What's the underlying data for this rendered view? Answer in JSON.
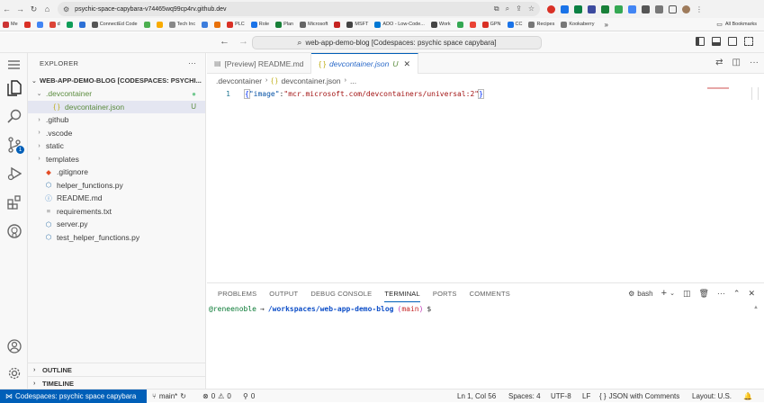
{
  "browser": {
    "url": "psychic-space-capybara-v74465wq99cp4rv.github.dev",
    "bookmarks": [
      {
        "label": "Me",
        "color": "#cc3333"
      },
      {
        "label": "",
        "color": "#d93025"
      },
      {
        "label": "",
        "color": "#4285f4"
      },
      {
        "label": "d",
        "color": "#dc4437"
      },
      {
        "label": "",
        "color": "#0f9d58"
      },
      {
        "label": "",
        "color": "#2c70d6"
      },
      {
        "label": "ConnectEd Code",
        "color": "#555555"
      },
      {
        "label": "",
        "color": "#4caf50"
      },
      {
        "label": "",
        "color": "#f9ab00"
      },
      {
        "label": "Tech Inc",
        "color": "#888888"
      },
      {
        "label": "",
        "color": "#3c7ddc"
      },
      {
        "label": "",
        "color": "#e8710a"
      },
      {
        "label": "PLC",
        "color": "#d93025"
      },
      {
        "label": "Role",
        "color": "#1a73e8"
      },
      {
        "label": "Plan",
        "color": "#188038"
      },
      {
        "label": "Microsoft",
        "color": "#666666"
      },
      {
        "label": "",
        "color": "#c5221f"
      },
      {
        "label": "MSFT",
        "color": "#444444"
      },
      {
        "label": "ADO - Low-Code...",
        "color": "#0078d4"
      },
      {
        "label": "Work",
        "color": "#444444"
      },
      {
        "label": "",
        "color": "#34a853"
      },
      {
        "label": "",
        "color": "#ea4335"
      },
      {
        "label": "GPN",
        "color": "#d93025"
      },
      {
        "label": "CC",
        "color": "#1a73e8"
      },
      {
        "label": "Recipes",
        "color": "#777777"
      },
      {
        "label": "Kookaberry",
        "color": "#777777"
      }
    ],
    "more_bookmarks": "»",
    "all_bookmarks": "All Bookmarks"
  },
  "title_bar": {
    "command_center": "web-app-demo-blog [Codespaces: psychic space capybara]"
  },
  "sidebar": {
    "header": "EXPLORER",
    "root": "WEB-APP-DEMO-BLOG [CODESPACES: PSYCHI...",
    "tree": [
      {
        "name": ".devcontainer",
        "kind": "folder",
        "open": true,
        "status": "●",
        "status_color": "#73c991",
        "name_color": "#5b8c3e"
      },
      {
        "name": "devcontainer.json",
        "kind": "json",
        "status": "U",
        "status_color": "#5b8c3e",
        "name_color": "#5b8c3e",
        "selected": true
      },
      {
        "name": ".github",
        "kind": "folder"
      },
      {
        "name": ".vscode",
        "kind": "folder"
      },
      {
        "name": "static",
        "kind": "folder"
      },
      {
        "name": "templates",
        "kind": "folder"
      },
      {
        "name": ".gitignore",
        "kind": "git"
      },
      {
        "name": "helper_functions.py",
        "kind": "py"
      },
      {
        "name": "README.md",
        "kind": "info"
      },
      {
        "name": "requirements.txt",
        "kind": "txt"
      },
      {
        "name": "server.py",
        "kind": "py"
      },
      {
        "name": "test_helper_functions.py",
        "kind": "py"
      }
    ],
    "outline": "OUTLINE",
    "timeline": "TIMELINE",
    "scm_badge": "1"
  },
  "editor": {
    "tabs": [
      {
        "label": "[Preview] README.md",
        "active": false
      },
      {
        "label": "devcontainer.json",
        "modifier": "U",
        "active": true
      }
    ],
    "breadcrumb": [
      ".devcontainer",
      "devcontainer.json",
      "..."
    ],
    "line_number": "1",
    "code": {
      "open_brace": "{",
      "key": "\"image\"",
      "colon": ":",
      "value": "\"mcr.microsoft.com/devcontainers/universal:2\"",
      "close_brace": "}"
    }
  },
  "panel": {
    "tabs": [
      "PROBLEMS",
      "OUTPUT",
      "DEBUG CONSOLE",
      "TERMINAL",
      "PORTS",
      "COMMENTS"
    ],
    "active_tab": "TERMINAL",
    "shell": "bash",
    "terminal": {
      "user": "@reneenoble",
      "arrow": "→",
      "path": "/workspaces/web-app-demo-blog",
      "branch_open": "(",
      "branch": "main",
      "branch_close": ")",
      "prompt": "$"
    }
  },
  "status_bar": {
    "remote": "Codespaces: psychic space capybara",
    "branch": "main*",
    "errors": "0",
    "warnings": "0",
    "ports": "0",
    "cursor": "Ln 1, Col 56",
    "spaces": "Spaces: 4",
    "encoding": "UTF-8",
    "eol": "LF",
    "language": "JSON with Comments",
    "layout": "Layout: U.S."
  },
  "colors": {
    "accent": "#005fb8",
    "untracked": "#5b8c3e"
  }
}
